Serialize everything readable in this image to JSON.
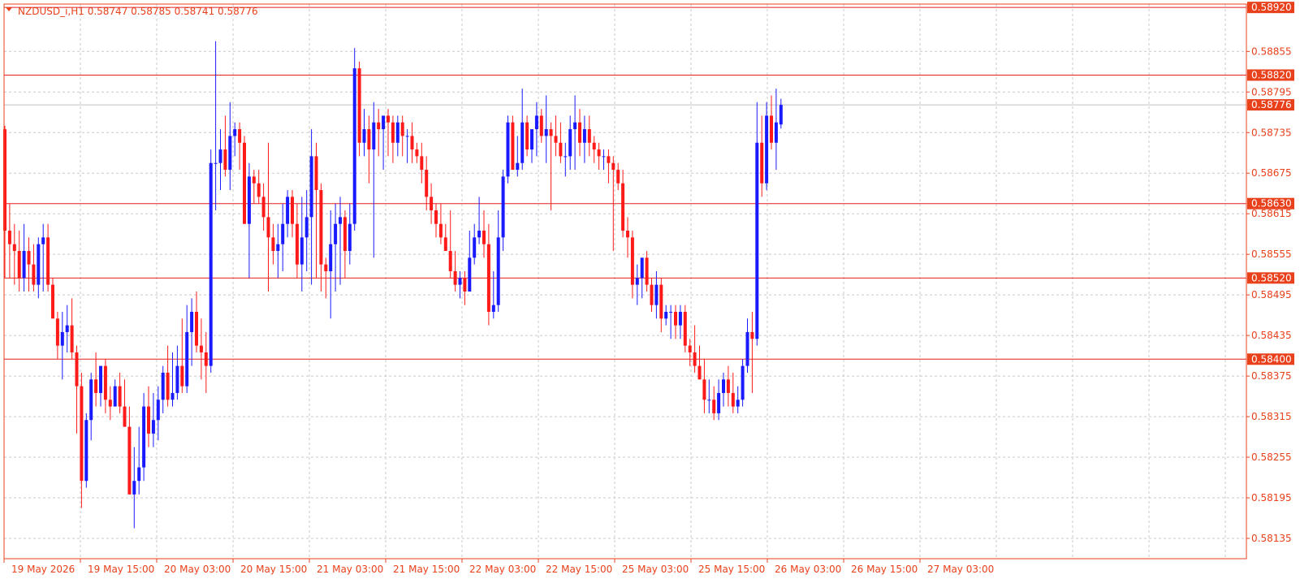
{
  "window": {
    "symbol_info": "NZDUSD_i,H1  0.58747 0.58785 0.58741 0.58776"
  },
  "colors": {
    "up_candle": "#1a1aff",
    "down_candle": "#ff1a1a",
    "grid": "#c8c8c8",
    "frame": "#e8411c",
    "axis_text": "#e8411c",
    "level_line": "#e41e1e",
    "bid_line": "#c0c0c0",
    "label_bg": "#e8411c",
    "label_text": "#ffffff"
  },
  "chart_data": {
    "type": "candlestick",
    "timeframe": "H1",
    "ylim": [
      0.58105,
      0.58925
    ],
    "y_ticks": [
      "0.58855",
      "0.58795",
      "0.58735",
      "0.58675",
      "0.58615",
      "0.58555",
      "0.58495",
      "0.58435",
      "0.58375",
      "0.58315",
      "0.58255",
      "0.58195",
      "0.58135"
    ],
    "x_ticks": [
      "19 May 2026",
      "19 May 15:00",
      "20 May 03:00",
      "20 May 15:00",
      "21 May 03:00",
      "21 May 15:00",
      "22 May 03:00",
      "22 May 15:00",
      "25 May 03:00",
      "25 May 15:00",
      "26 May 03:00",
      "26 May 15:00",
      "27 May 03:00"
    ],
    "horizontal_levels": [
      "0.58920",
      "0.58820",
      "0.58630",
      "0.58520",
      "0.58400"
    ],
    "current_price": "0.58776",
    "candles": [
      [
        0.5874,
        0.58745,
        0.5852,
        0.5859
      ],
      [
        0.5859,
        0.5863,
        0.5852,
        0.5857
      ],
      [
        0.5857,
        0.586,
        0.5851,
        0.5856
      ],
      [
        0.5856,
        0.5859,
        0.585,
        0.5852
      ],
      [
        0.5852,
        0.586,
        0.585,
        0.5856
      ],
      [
        0.5856,
        0.5858,
        0.585,
        0.5854
      ],
      [
        0.5854,
        0.5857,
        0.585,
        0.5851
      ],
      [
        0.5851,
        0.5858,
        0.5849,
        0.5857
      ],
      [
        0.5857,
        0.586,
        0.585,
        0.5858
      ],
      [
        0.5858,
        0.586,
        0.585,
        0.5851
      ],
      [
        0.5851,
        0.5852,
        0.5847,
        0.5846
      ],
      [
        0.5846,
        0.5847,
        0.584,
        0.5842
      ],
      [
        0.5842,
        0.5847,
        0.5837,
        0.5844
      ],
      [
        0.5844,
        0.5848,
        0.5841,
        0.5845
      ],
      [
        0.5845,
        0.5849,
        0.584,
        0.5841
      ],
      [
        0.5841,
        0.5842,
        0.5829,
        0.5836
      ],
      [
        0.5836,
        0.5838,
        0.5818,
        0.5822
      ],
      [
        0.5822,
        0.5832,
        0.5821,
        0.5831
      ],
      [
        0.5831,
        0.5838,
        0.5828,
        0.5837
      ],
      [
        0.5837,
        0.5841,
        0.5833,
        0.5835
      ],
      [
        0.5835,
        0.5839,
        0.5833,
        0.5839
      ],
      [
        0.5839,
        0.584,
        0.5832,
        0.5834
      ],
      [
        0.5834,
        0.5836,
        0.5831,
        0.5833
      ],
      [
        0.5833,
        0.5837,
        0.5833,
        0.5836
      ],
      [
        0.5836,
        0.5838,
        0.5832,
        0.5833
      ],
      [
        0.5833,
        0.5837,
        0.583,
        0.583
      ],
      [
        0.583,
        0.5833,
        0.582,
        0.582
      ],
      [
        0.582,
        0.5827,
        0.5815,
        0.5822
      ],
      [
        0.5822,
        0.583,
        0.582,
        0.5824
      ],
      [
        0.5824,
        0.5835,
        0.5822,
        0.5833
      ],
      [
        0.5833,
        0.5836,
        0.5827,
        0.5829
      ],
      [
        0.5829,
        0.5835,
        0.5827,
        0.5831
      ],
      [
        0.5831,
        0.5836,
        0.5828,
        0.5834
      ],
      [
        0.5834,
        0.5839,
        0.5832,
        0.5838
      ],
      [
        0.5838,
        0.5842,
        0.5833,
        0.5834
      ],
      [
        0.5834,
        0.5841,
        0.5833,
        0.5835
      ],
      [
        0.5835,
        0.5842,
        0.5834,
        0.5839
      ],
      [
        0.5839,
        0.5846,
        0.5835,
        0.5836
      ],
      [
        0.5836,
        0.5848,
        0.5835,
        0.5844
      ],
      [
        0.5844,
        0.5849,
        0.5839,
        0.5847
      ],
      [
        0.5847,
        0.585,
        0.5841,
        0.5842
      ],
      [
        0.5842,
        0.5846,
        0.5837,
        0.5841
      ],
      [
        0.5841,
        0.5844,
        0.5835,
        0.5839
      ],
      [
        0.5839,
        0.5871,
        0.5838,
        0.5869
      ],
      [
        0.5869,
        0.5887,
        0.5862,
        0.5869
      ],
      [
        0.5869,
        0.5874,
        0.5865,
        0.5871
      ],
      [
        0.5871,
        0.5876,
        0.5867,
        0.5868
      ],
      [
        0.5868,
        0.5878,
        0.5865,
        0.5873
      ],
      [
        0.5873,
        0.5875,
        0.587,
        0.5874
      ],
      [
        0.5874,
        0.5875,
        0.5868,
        0.5872
      ],
      [
        0.5872,
        0.5873,
        0.586,
        0.586
      ],
      [
        0.586,
        0.5869,
        0.5852,
        0.5867
      ],
      [
        0.5867,
        0.5868,
        0.5863,
        0.5866
      ],
      [
        0.5866,
        0.5868,
        0.5863,
        0.5864
      ],
      [
        0.5864,
        0.5866,
        0.5859,
        0.5861
      ],
      [
        0.5861,
        0.5872,
        0.585,
        0.5858
      ],
      [
        0.5858,
        0.586,
        0.5854,
        0.5856
      ],
      [
        0.5856,
        0.586,
        0.5852,
        0.5857
      ],
      [
        0.5857,
        0.5863,
        0.5853,
        0.586
      ],
      [
        0.586,
        0.5865,
        0.5858,
        0.5864
      ],
      [
        0.5864,
        0.5865,
        0.5858,
        0.586
      ],
      [
        0.586,
        0.5863,
        0.5852,
        0.5854
      ],
      [
        0.5854,
        0.5864,
        0.585,
        0.5858
      ],
      [
        0.5858,
        0.5865,
        0.5853,
        0.5861
      ],
      [
        0.5861,
        0.5874,
        0.5851,
        0.587
      ],
      [
        0.587,
        0.5872,
        0.5852,
        0.5865
      ],
      [
        0.5865,
        0.5866,
        0.585,
        0.5854
      ],
      [
        0.5854,
        0.5855,
        0.5849,
        0.5853
      ],
      [
        0.5853,
        0.5862,
        0.5846,
        0.5857
      ],
      [
        0.5857,
        0.5863,
        0.585,
        0.586
      ],
      [
        0.586,
        0.5864,
        0.5851,
        0.5861
      ],
      [
        0.5861,
        0.5862,
        0.5852,
        0.5856
      ],
      [
        0.5856,
        0.5863,
        0.5854,
        0.586
      ],
      [
        0.586,
        0.5886,
        0.5859,
        0.5883
      ],
      [
        0.5883,
        0.5884,
        0.587,
        0.5872
      ],
      [
        0.5872,
        0.5877,
        0.587,
        0.5874
      ],
      [
        0.5874,
        0.5876,
        0.5866,
        0.5871
      ],
      [
        0.5871,
        0.5878,
        0.5855,
        0.5875
      ],
      [
        0.5875,
        0.5877,
        0.587,
        0.5874
      ],
      [
        0.5874,
        0.5876,
        0.5868,
        0.5876
      ],
      [
        0.5876,
        0.5877,
        0.587,
        0.5875
      ],
      [
        0.5875,
        0.5876,
        0.5869,
        0.5872
      ],
      [
        0.5872,
        0.5876,
        0.587,
        0.5875
      ],
      [
        0.5875,
        0.5876,
        0.587,
        0.5873
      ],
      [
        0.5873,
        0.5874,
        0.5869,
        0.5873
      ],
      [
        0.5873,
        0.5875,
        0.5869,
        0.5871
      ],
      [
        0.5871,
        0.5872,
        0.5869,
        0.587
      ],
      [
        0.587,
        0.5872,
        0.5866,
        0.5868
      ],
      [
        0.5868,
        0.587,
        0.5862,
        0.5864
      ],
      [
        0.5864,
        0.5866,
        0.586,
        0.5862
      ],
      [
        0.5862,
        0.5863,
        0.5858,
        0.586
      ],
      [
        0.586,
        0.5863,
        0.5857,
        0.5858
      ],
      [
        0.5858,
        0.586,
        0.5856,
        0.5856
      ],
      [
        0.5856,
        0.5862,
        0.5852,
        0.5853
      ],
      [
        0.5853,
        0.5856,
        0.585,
        0.5851
      ],
      [
        0.5851,
        0.5853,
        0.5849,
        0.5852
      ],
      [
        0.5852,
        0.5853,
        0.5848,
        0.585
      ],
      [
        0.585,
        0.5859,
        0.585,
        0.5855
      ],
      [
        0.5855,
        0.586,
        0.5854,
        0.5858
      ],
      [
        0.5858,
        0.5864,
        0.5857,
        0.5859
      ],
      [
        0.5859,
        0.5862,
        0.5855,
        0.5857
      ],
      [
        0.5857,
        0.586,
        0.5845,
        0.5847
      ],
      [
        0.5847,
        0.5853,
        0.5846,
        0.5848
      ],
      [
        0.5848,
        0.5862,
        0.5847,
        0.5858
      ],
      [
        0.5858,
        0.5868,
        0.5856,
        0.5867
      ],
      [
        0.5867,
        0.5876,
        0.5866,
        0.5875
      ],
      [
        0.5875,
        0.5876,
        0.5868,
        0.5868
      ],
      [
        0.5868,
        0.5873,
        0.5867,
        0.5869
      ],
      [
        0.5869,
        0.588,
        0.5868,
        0.5875
      ],
      [
        0.5875,
        0.5876,
        0.587,
        0.5871
      ],
      [
        0.5871,
        0.5873,
        0.5869,
        0.5874
      ],
      [
        0.5874,
        0.5878,
        0.587,
        0.5876
      ],
      [
        0.5876,
        0.5877,
        0.5872,
        0.5873
      ],
      [
        0.5873,
        0.5879,
        0.5869,
        0.5874
      ],
      [
        0.5874,
        0.5875,
        0.5862,
        0.5873
      ],
      [
        0.5873,
        0.5876,
        0.587,
        0.5872
      ],
      [
        0.5872,
        0.5875,
        0.5869,
        0.587
      ],
      [
        0.587,
        0.5872,
        0.5867,
        0.587
      ],
      [
        0.587,
        0.5876,
        0.5868,
        0.5874
      ],
      [
        0.5874,
        0.5879,
        0.5868,
        0.5875
      ],
      [
        0.5875,
        0.5877,
        0.587,
        0.5872
      ],
      [
        0.5872,
        0.5876,
        0.5869,
        0.5874
      ],
      [
        0.5874,
        0.5876,
        0.587,
        0.5872
      ],
      [
        0.5872,
        0.5873,
        0.5869,
        0.5871
      ],
      [
        0.5871,
        0.5872,
        0.5868,
        0.587
      ],
      [
        0.587,
        0.5871,
        0.5868,
        0.587
      ],
      [
        0.587,
        0.5871,
        0.5866,
        0.5869
      ],
      [
        0.5869,
        0.587,
        0.5856,
        0.5868
      ],
      [
        0.5868,
        0.5869,
        0.5865,
        0.5866
      ],
      [
        0.5866,
        0.5868,
        0.5858,
        0.5859
      ],
      [
        0.5859,
        0.5861,
        0.5855,
        0.5858
      ],
      [
        0.5858,
        0.5859,
        0.5849,
        0.5851
      ],
      [
        0.5851,
        0.5854,
        0.5848,
        0.5852
      ],
      [
        0.5852,
        0.5855,
        0.5849,
        0.5855
      ],
      [
        0.5855,
        0.5856,
        0.585,
        0.5851
      ],
      [
        0.5851,
        0.5852,
        0.5847,
        0.5848
      ],
      [
        0.5848,
        0.5853,
        0.5846,
        0.5851
      ],
      [
        0.5851,
        0.5852,
        0.5844,
        0.5846
      ],
      [
        0.5846,
        0.5848,
        0.5845,
        0.5847
      ],
      [
        0.5847,
        0.5848,
        0.5843,
        0.5847
      ],
      [
        0.5847,
        0.5848,
        0.5843,
        0.5845
      ],
      [
        0.5845,
        0.5848,
        0.5843,
        0.5847
      ],
      [
        0.5847,
        0.5848,
        0.5841,
        0.5842
      ],
      [
        0.5842,
        0.5843,
        0.5839,
        0.5841
      ],
      [
        0.5841,
        0.5845,
        0.5838,
        0.5839
      ],
      [
        0.5839,
        0.5842,
        0.5837,
        0.5837
      ],
      [
        0.5837,
        0.584,
        0.5832,
        0.5834
      ],
      [
        0.5834,
        0.5837,
        0.5832,
        0.5834
      ],
      [
        0.5834,
        0.5836,
        0.5831,
        0.5832
      ],
      [
        0.5832,
        0.5837,
        0.5831,
        0.5835
      ],
      [
        0.5835,
        0.5838,
        0.5833,
        0.5837
      ],
      [
        0.5837,
        0.5839,
        0.5833,
        0.5835
      ],
      [
        0.5835,
        0.5838,
        0.5832,
        0.5833
      ],
      [
        0.5833,
        0.5836,
        0.5832,
        0.5834
      ],
      [
        0.5834,
        0.584,
        0.5833,
        0.5839
      ],
      [
        0.5839,
        0.5846,
        0.5838,
        0.5844
      ],
      [
        0.5844,
        0.5847,
        0.5835,
        0.5843
      ],
      [
        0.5843,
        0.5878,
        0.5842,
        0.5872
      ],
      [
        0.5872,
        0.5876,
        0.5864,
        0.5866
      ],
      [
        0.5866,
        0.5878,
        0.5865,
        0.5876
      ],
      [
        0.5876,
        0.5879,
        0.5871,
        0.5872
      ],
      [
        0.5872,
        0.588,
        0.5868,
        0.5875
      ],
      [
        0.58747,
        0.58785,
        0.58741,
        0.58776
      ]
    ]
  }
}
